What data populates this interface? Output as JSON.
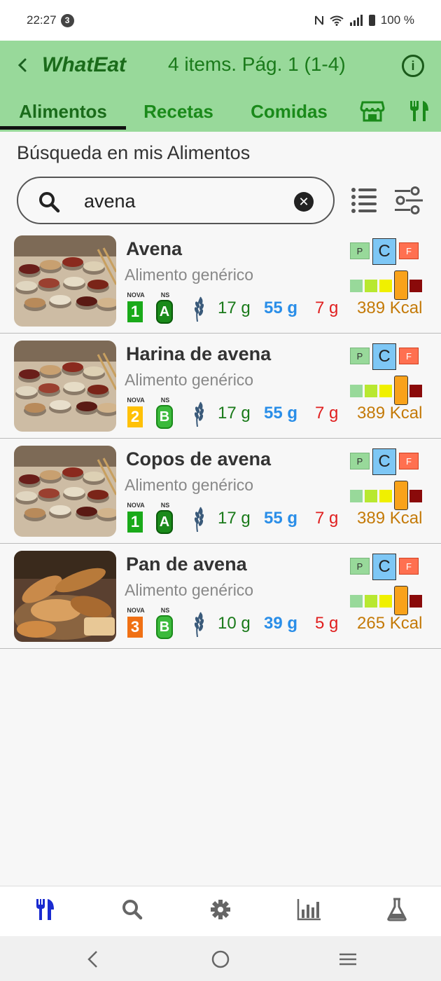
{
  "status": {
    "time": "22:27",
    "notif_count": "3",
    "battery": "100 %"
  },
  "header": {
    "title": "WhatEat",
    "page_info": "4 items. Pág. 1 (1-4)"
  },
  "tabs": [
    {
      "label": "Alimentos",
      "active": true
    },
    {
      "label": "Recetas",
      "active": false
    },
    {
      "label": "Comidas",
      "active": false
    }
  ],
  "section_title": "Búsqueda en mis Alimentos",
  "search": {
    "value": "avena"
  },
  "labels": {
    "p": "P",
    "c": "C",
    "f": "F",
    "nova": "NOVA",
    "ns": "NS"
  },
  "colors": {
    "header": "#98d99a",
    "protein": "#1a7a1a",
    "carbs": "#2a8ee8",
    "fat": "#e02020",
    "kcal": "#c47a08",
    "nova1": "#1aaa1a",
    "nova2": "#ffc107",
    "nova3": "#f07014",
    "ns_a": "#1a8a1a",
    "ns_b": "#3cba3c"
  },
  "items": [
    {
      "name": "Avena",
      "type": "Alimento genérico",
      "nova": "1",
      "ns": "A",
      "protein": "17 g",
      "carbs": "55 g",
      "fat": "7 g",
      "kcal": "389 Kcal",
      "image": "grains-bowls"
    },
    {
      "name": "Harina de avena",
      "type": "Alimento genérico",
      "nova": "2",
      "ns": "B",
      "protein": "17 g",
      "carbs": "55 g",
      "fat": "7 g",
      "kcal": "389 Kcal",
      "image": "grains-bowls"
    },
    {
      "name": "Copos de avena",
      "type": "Alimento genérico",
      "nova": "1",
      "ns": "A",
      "protein": "17 g",
      "carbs": "55 g",
      "fat": "7 g",
      "kcal": "389 Kcal",
      "image": "grains-bowls"
    },
    {
      "name": "Pan de avena",
      "type": "Alimento genérico",
      "nova": "3",
      "ns": "B",
      "protein": "10 g",
      "carbs": "39 g",
      "fat": "5 g",
      "kcal": "265 Kcal",
      "image": "bread-basket"
    }
  ],
  "bottom_nav": [
    {
      "icon": "utensils-icon",
      "active": true
    },
    {
      "icon": "search-icon",
      "active": false
    },
    {
      "icon": "gear-icon",
      "active": false
    },
    {
      "icon": "bar-chart-icon",
      "active": false
    },
    {
      "icon": "flask-icon",
      "active": false
    }
  ]
}
